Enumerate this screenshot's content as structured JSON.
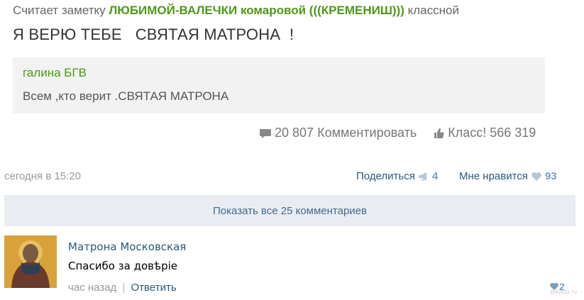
{
  "card": {
    "prefix": "Считает заметку",
    "author": "ЛЮБИМОЙ-ВАЛЕЧКИ комаровой (((КРЕМЕНИШ)))",
    "suffix": "классной",
    "headline": "Я ВЕРЮ ТЕБЕ   СВЯТАЯ МАТРОНА  !",
    "quote": {
      "author": "галина БГВ",
      "text": "Всем ,кто верит .СВЯТАЯ МАТРОНА"
    },
    "comments_count": "20 807",
    "comment_label": "Комментировать",
    "klass_label": "Класс!",
    "klass_count": "566 319"
  },
  "post": {
    "date": "сегодня в 15:20",
    "share_label": "Поделиться",
    "share_count": "4",
    "like_label": "Мне нравится",
    "like_count": "93"
  },
  "show_all": "Показать все 25 комментариев",
  "comment": {
    "author": "Матрона Московская",
    "text": "Спасибо за довѣріе",
    "time": "час назад",
    "separator": "|",
    "reply": "Ответить",
    "like_count": "2"
  },
  "watermark": "pikabu.ru",
  "colors": {
    "accent_green": "#4c9a17",
    "link_blue": "#2b587a",
    "button_bg": "#e9edf1",
    "count_blue": "#7a9bbe"
  },
  "icons": [
    "speech-bubble-icon",
    "klass-thumb-icon",
    "megaphone-icon",
    "heart-icon"
  ]
}
